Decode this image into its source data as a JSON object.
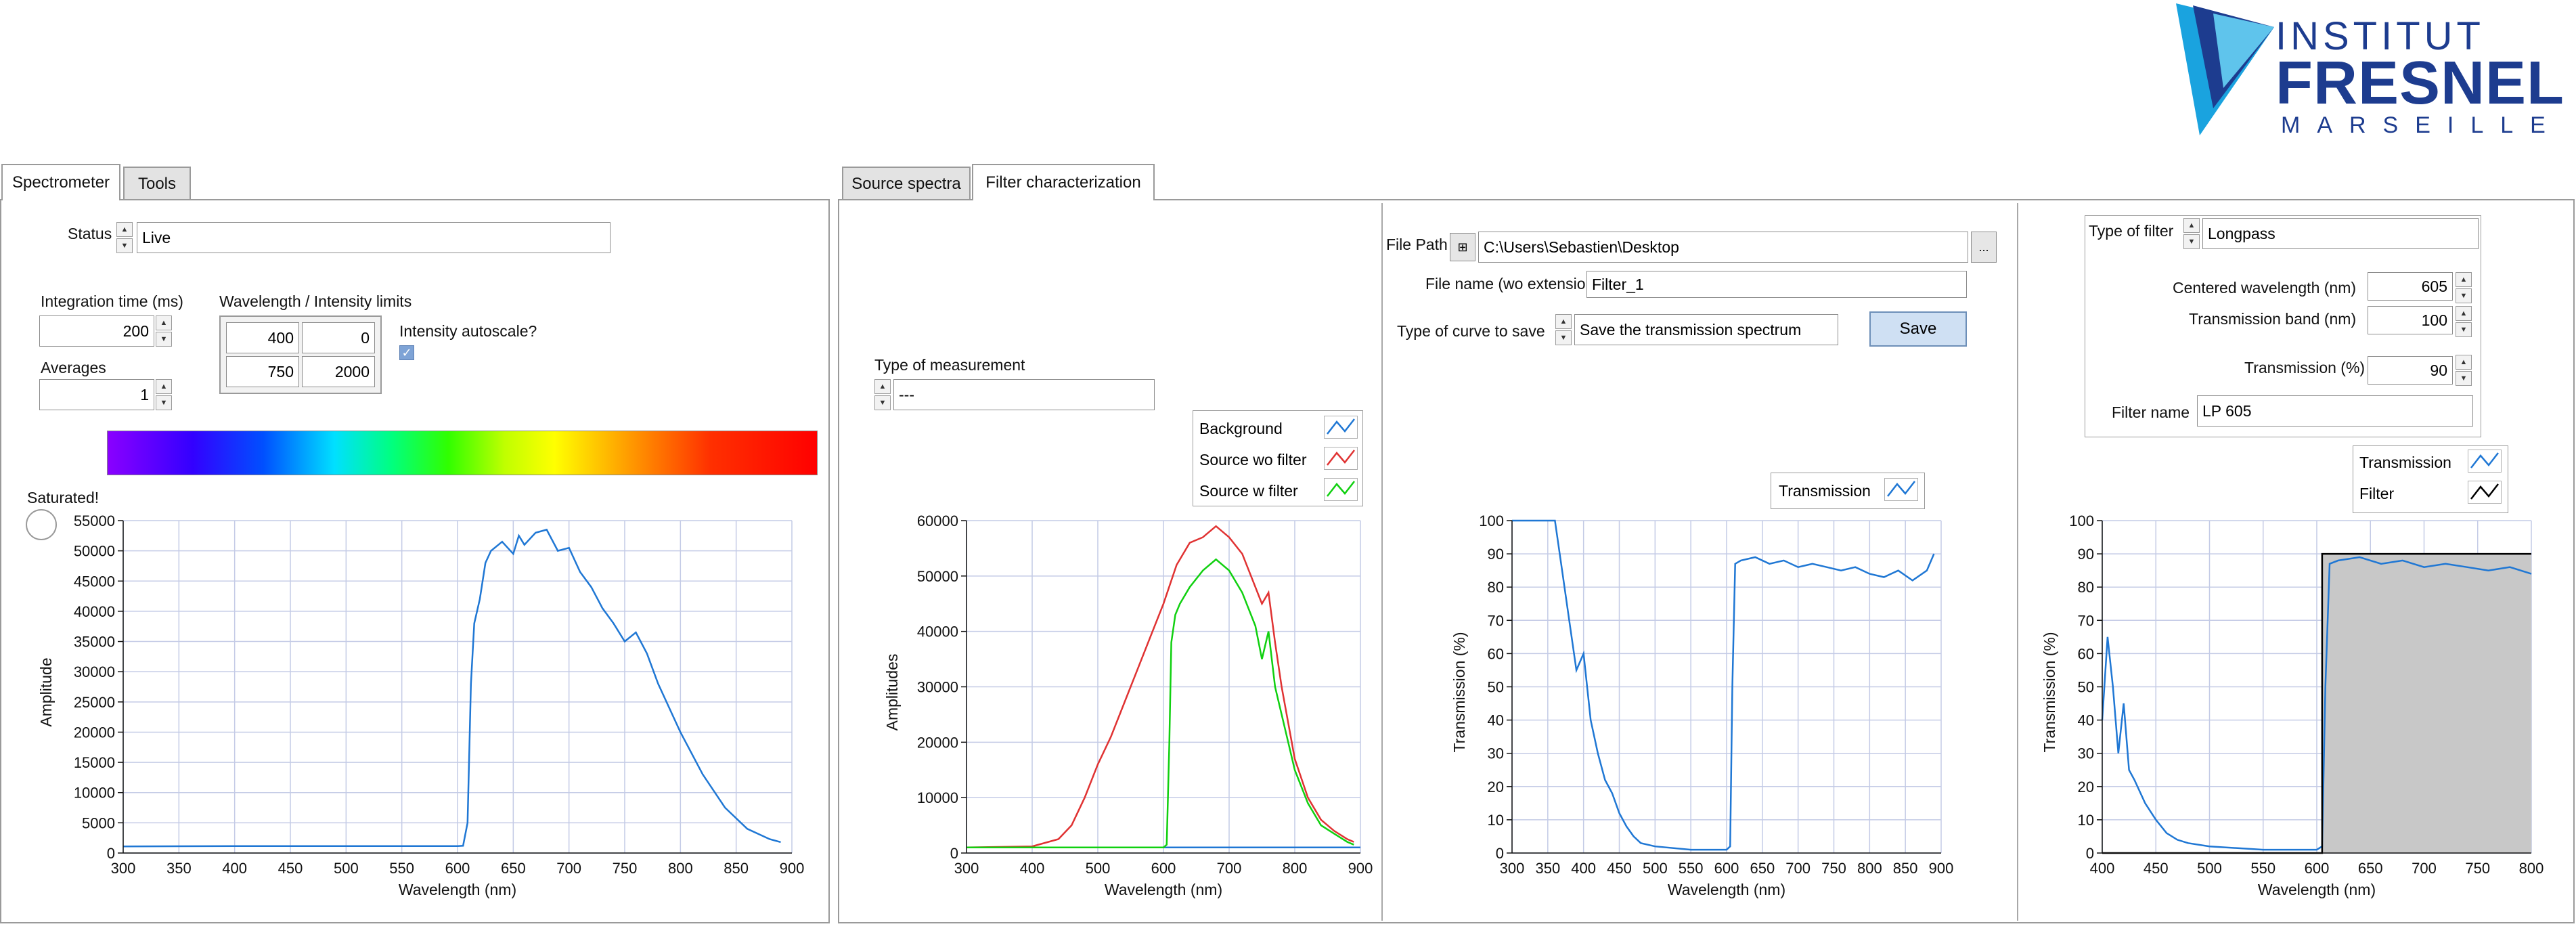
{
  "logo": {
    "line1": "INSTITUT",
    "line2": "FRESNEL",
    "line3": "MARSEILLE"
  },
  "left_tabs": [
    "Spectrometer",
    "Tools"
  ],
  "right_tabs": [
    "Source spectra",
    "Filter characterization"
  ],
  "spectrometer": {
    "status_label": "Status",
    "status_value": "Live",
    "integration_label": "Integration time (ms)",
    "integration_value": "200",
    "averages_label": "Averages",
    "averages_value": "1",
    "limits_label": "Wavelength / Intensity limits",
    "wl_min": "400",
    "int_min": "0",
    "wl_max": "750",
    "int_max": "2000",
    "autoscale_label": "Intensity autoscale?",
    "autoscale_checked": true,
    "saturated_label": "Saturated!"
  },
  "measurement": {
    "type_label": "Type of measurement",
    "type_value": "---",
    "legend": [
      "Background",
      "Source wo filter",
      "Source w filter"
    ]
  },
  "save": {
    "file_path_label": "File Path",
    "file_path_value": "C:\\Users\\Sebastien\\Desktop",
    "browse_label": "...",
    "file_name_label": "File name (wo extension)",
    "file_name_value": "Filter_1",
    "curve_label": "Type of curve to save",
    "curve_value": "Save the transmission spectrum",
    "save_button": "Save",
    "legend": [
      "Transmission"
    ]
  },
  "filter": {
    "type_label": "Type of filter",
    "type_value": "Longpass",
    "centered_label": "Centered wavelength (nm)",
    "centered_value": "605",
    "band_label": "Transmission band (nm)",
    "band_value": "100",
    "transmission_label": "Transmission (%)",
    "transmission_value": "90",
    "name_label": "Filter name",
    "name_value": "LP  605",
    "legend": [
      "Transmission",
      "Filter"
    ]
  },
  "colors": {
    "blue": "#1f77d4",
    "red": "#e03232",
    "green": "#10d010",
    "black": "#000000",
    "filter_fill": "#c8c8c8"
  },
  "chart_data": [
    {
      "type": "line",
      "title": "",
      "xlabel": "Wavelength (nm)",
      "ylabel": "Amplitude",
      "xlim": [
        300,
        900
      ],
      "ylim": [
        0,
        55000
      ],
      "xticks": [
        300,
        350,
        400,
        450,
        500,
        550,
        600,
        650,
        700,
        750,
        800,
        850,
        900
      ],
      "yticks": [
        0,
        5000,
        10000,
        15000,
        20000,
        25000,
        30000,
        35000,
        40000,
        45000,
        50000,
        55000
      ],
      "grid": true,
      "series": [
        {
          "color": "blue",
          "x": [
            300,
            400,
            500,
            600,
            605,
            609,
            612,
            615,
            620,
            625,
            630,
            640,
            650,
            655,
            660,
            670,
            680,
            690,
            700,
            710,
            720,
            730,
            740,
            750,
            760,
            770,
            780,
            800,
            820,
            840,
            860,
            880,
            890
          ],
          "y": [
            1100,
            1150,
            1150,
            1150,
            1200,
            5000,
            28000,
            38000,
            42000,
            48000,
            50000,
            51500,
            49500,
            52500,
            51000,
            53000,
            53500,
            50000,
            50500,
            46500,
            44000,
            40500,
            38000,
            35000,
            36500,
            33000,
            28000,
            20000,
            13000,
            7500,
            4000,
            2300,
            1800
          ]
        }
      ]
    },
    {
      "type": "line",
      "title": "",
      "xlabel": "Wavelength (nm)",
      "ylabel": "Amplitudes",
      "xlim": [
        300,
        900
      ],
      "ylim": [
        0,
        60000
      ],
      "xticks": [
        300,
        400,
        500,
        600,
        700,
        800,
        900
      ],
      "yticks": [
        0,
        10000,
        20000,
        30000,
        40000,
        50000,
        60000
      ],
      "grid": true,
      "legend": "top-right",
      "series": [
        {
          "name": "Background",
          "color": "blue",
          "x": [
            300,
            900
          ],
          "y": [
            1000,
            1000
          ]
        },
        {
          "name": "Source wo filter",
          "color": "red",
          "x": [
            300,
            400,
            440,
            460,
            480,
            500,
            520,
            540,
            560,
            580,
            600,
            620,
            640,
            660,
            680,
            700,
            720,
            740,
            750,
            760,
            770,
            780,
            800,
            820,
            840,
            860,
            880,
            890
          ],
          "y": [
            1000,
            1200,
            2500,
            5000,
            10000,
            16000,
            21000,
            27000,
            33000,
            39000,
            45000,
            52000,
            56000,
            57000,
            59000,
            57000,
            54000,
            48000,
            45000,
            47000,
            38000,
            30000,
            17000,
            10000,
            6000,
            4000,
            2500,
            2000
          ]
        },
        {
          "name": "Source w filter",
          "color": "green",
          "x": [
            300,
            600,
            605,
            609,
            612,
            618,
            625,
            640,
            660,
            680,
            700,
            720,
            740,
            750,
            760,
            770,
            780,
            800,
            820,
            840,
            860,
            880,
            890
          ],
          "y": [
            1000,
            1000,
            1500,
            20000,
            38000,
            43000,
            45000,
            48000,
            51000,
            53000,
            51000,
            47000,
            41000,
            35000,
            40000,
            30000,
            25000,
            15000,
            9000,
            5000,
            3500,
            2000,
            1500
          ]
        }
      ]
    },
    {
      "type": "line",
      "title": "",
      "xlabel": "Wavelength (nm)",
      "ylabel": "Transmission (%)",
      "xlim": [
        300,
        900
      ],
      "ylim": [
        0,
        100
      ],
      "xticks": [
        300,
        350,
        400,
        450,
        500,
        550,
        600,
        650,
        700,
        750,
        800,
        850,
        900
      ],
      "yticks": [
        0,
        10,
        20,
        30,
        40,
        50,
        60,
        70,
        80,
        90,
        100
      ],
      "grid": true,
      "legend": "top-right",
      "series": [
        {
          "name": "Transmission",
          "color": "blue",
          "x": [
            300,
            310,
            320,
            330,
            340,
            350,
            360,
            370,
            380,
            390,
            400,
            410,
            420,
            430,
            440,
            450,
            460,
            470,
            480,
            500,
            550,
            600,
            605,
            608,
            612,
            620,
            640,
            660,
            680,
            700,
            720,
            740,
            760,
            780,
            800,
            820,
            840,
            860,
            880,
            890
          ],
          "y": [
            100,
            100,
            100,
            100,
            100,
            100,
            100,
            85,
            70,
            55,
            60,
            40,
            30,
            22,
            18,
            12,
            8,
            5,
            3,
            2,
            1,
            1,
            2,
            50,
            87,
            88,
            89,
            87,
            88,
            86,
            87,
            86,
            85,
            86,
            84,
            83,
            85,
            82,
            85,
            90
          ]
        }
      ]
    },
    {
      "type": "area",
      "title": "",
      "xlabel": "Wavelength (nm)",
      "ylabel": "Transmission (%)",
      "xlim": [
        400,
        800
      ],
      "ylim": [
        0,
        100
      ],
      "xticks": [
        400,
        450,
        500,
        550,
        600,
        650,
        700,
        750,
        800
      ],
      "yticks": [
        0,
        10,
        20,
        30,
        40,
        50,
        60,
        70,
        80,
        90,
        100
      ],
      "grid": true,
      "legend": "top-right",
      "series": [
        {
          "name": "Transmission",
          "color": "blue",
          "x": [
            400,
            405,
            410,
            415,
            420,
            425,
            430,
            440,
            450,
            460,
            470,
            480,
            500,
            550,
            600,
            605,
            608,
            612,
            620,
            640,
            660,
            680,
            700,
            720,
            740,
            760,
            780,
            800
          ],
          "y": [
            40,
            65,
            50,
            30,
            45,
            25,
            22,
            15,
            10,
            6,
            4,
            3,
            2,
            1,
            1,
            2,
            50,
            87,
            88,
            89,
            87,
            88,
            86,
            87,
            86,
            85,
            86,
            84
          ]
        },
        {
          "name": "Filter",
          "color": "black",
          "x": [
            400,
            605,
            605,
            800
          ],
          "y": [
            0,
            0,
            90,
            90
          ]
        }
      ]
    }
  ]
}
